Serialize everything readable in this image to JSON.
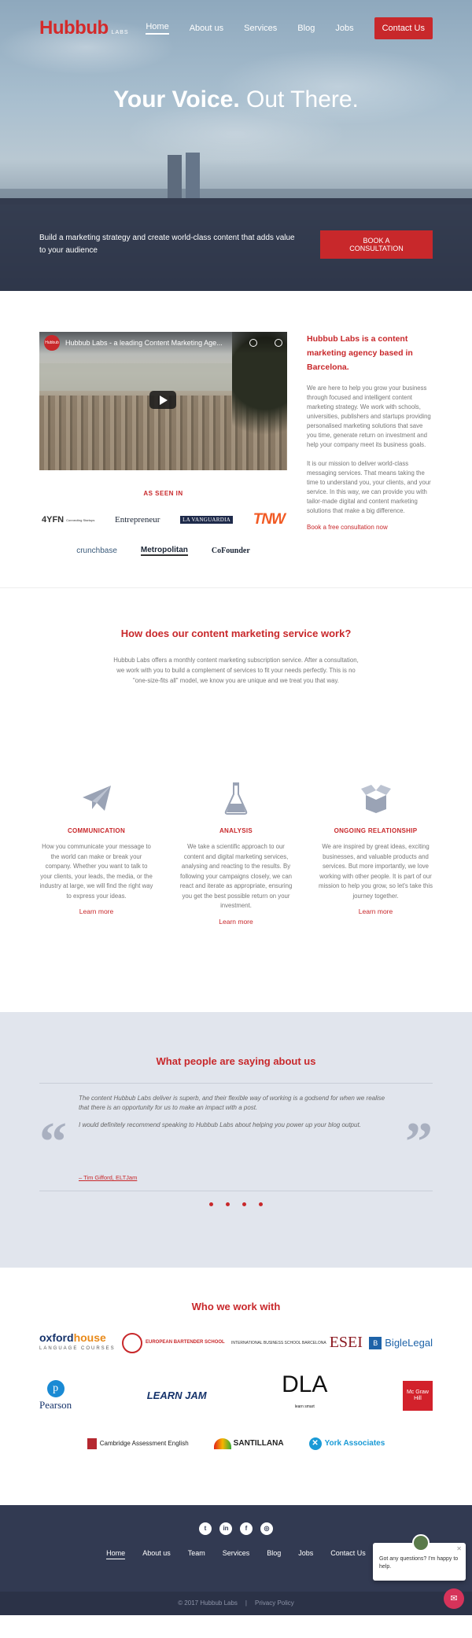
{
  "brand": {
    "name": "Hubbub",
    "suffix": "LABS"
  },
  "nav": {
    "items": [
      "Home",
      "About us",
      "Services",
      "Blog",
      "Jobs"
    ],
    "contact": "Contact Us"
  },
  "hero": {
    "headline_bold": "Your Voice.",
    "headline_rest": "Out There.",
    "banner_text": "Build a marketing strategy and create world-class content that adds value to your audience",
    "cta": "BOOK A CONSULTATION"
  },
  "video": {
    "logo_text": "Hubbub",
    "title": "Hubbub Labs - a leading Content Marketing Age..."
  },
  "seen_in": {
    "label": "AS SEEN IN",
    "logos": [
      "4YFN",
      "Connecting Startups",
      "Entrepreneur",
      "LA VANGUARDIA",
      "TNW",
      "crunchbase",
      "Metropolitan",
      "CoFounder"
    ]
  },
  "intro": {
    "heading": "Hubbub Labs is a content marketing agency based in Barcelona.",
    "p1": "We are here to help you grow your business through focused and intelligent content marketing strategy. We work with schools, universities, publishers and startups providing personalised marketing solutions that save you time, generate return on investment and help your company meet its business goals.",
    "p2": "It is our mission to deliver world-class messaging services. That means taking the time to understand you, your clients, and your service. In this way, we can provide you with tailor-made digital and content marketing solutions that make a big difference.",
    "link": "Book a free consultation now"
  },
  "how": {
    "heading": "How does our content marketing service work?",
    "text": "Hubbub Labs offers a monthly content marketing subscription service. After a consultation, we work with you to build a complement of services to fit your needs perfectly. This is no \"one-size-fits all\" model, we know you are unique and we treat you that way."
  },
  "features": [
    {
      "icon": "paper-plane-icon",
      "title": "COMMUNICATION",
      "text": "How you communicate your message to the world can make or break your company. Whether you want to talk to your clients, your leads, the media, or the industry at large, we will find the right way to express your ideas.",
      "link": "Learn more"
    },
    {
      "icon": "flask-icon",
      "title": "ANALYSIS",
      "text": "We take a scientific approach to our content and digital marketing services, analysing and reacting to the results. By following your campaigns closely, we can react and iterate as appropriate, ensuring you get the best possible return on your investment.",
      "link": "Learn more"
    },
    {
      "icon": "box-icon",
      "title": "ONGOING RELATIONSHIP",
      "text": "We are inspired by great ideas, exciting businesses, and valuable products and services. But more importantly, we love working with other people. It is part of our mission to help you grow, so let's take this journey together.",
      "link": "Learn more"
    }
  ],
  "testimonials": {
    "heading": "What people are saying about us",
    "quote1": "The content Hubbub Labs deliver is superb, and their flexible way of working is a godsend for when we realise that there is an opportunity for us to make an impact with a post.",
    "quote2": "I would definitely recommend speaking to Hubbub Labs about helping you power up your blog output.",
    "author": "– Tim Gifford, ELTJam"
  },
  "clients": {
    "heading": "Who we work with",
    "oxford": {
      "a": "oxford",
      "b": "house",
      "c": "LANGUAGE COURSES"
    },
    "ebs": "EUROPEAN BARTENDER SCHOOL",
    "esei_small": "INTERNATIONAL BUSINESS SCHOOL BARCELONA",
    "esei": "ESEI",
    "bigle": "BigleLegal",
    "pearson": "Pearson",
    "learnjam": "LEARN JAM",
    "dla": "DLA",
    "dla_small": "learn smart",
    "mgh": "Mc Graw Hill",
    "cambridge": "Cambridge Assessment English",
    "santillana": "SANTILLANA",
    "york": "York Associates"
  },
  "footer": {
    "social": [
      "twitter-icon",
      "linkedin-icon",
      "facebook-icon",
      "instagram-icon"
    ],
    "menu": [
      "Home",
      "About us",
      "Team",
      "Services",
      "Blog",
      "Jobs",
      "Contact Us"
    ],
    "copyright": "© 2017 Hubbub Labs",
    "privacy": "Privacy Policy"
  },
  "chat": {
    "text": "Got any questions? I'm happy to help."
  },
  "colors": {
    "accent": "#c8282b",
    "dark": "#323a52",
    "testimonial_bg": "#e1e5ed"
  }
}
